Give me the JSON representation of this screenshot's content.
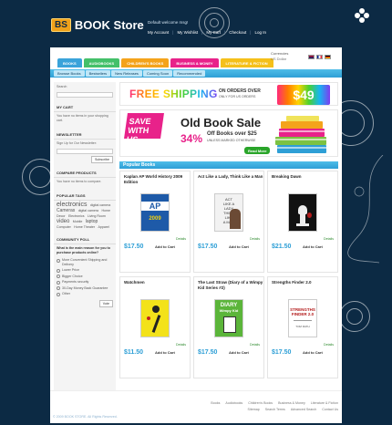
{
  "header": {
    "logo_badge": "BS",
    "logo_text": "BOOK Store",
    "welcome": "Default welcome msg!",
    "top_links": [
      "My Account",
      "My Wishlist",
      "My Cart",
      "Checkout",
      "Log In"
    ]
  },
  "nav": {
    "tabs": [
      {
        "label": "BOOKS",
        "color": "#3aa3da"
      },
      {
        "label": "AUDIOBOOKS",
        "color": "#44c06a"
      },
      {
        "label": "CHILDREN'S BOOKS",
        "color": "#f4a31b"
      },
      {
        "label": "BUSINESS & MONEY",
        "color": "#e8228a"
      },
      {
        "label": "LITERATURE & FICTION",
        "color": "#f5c01a"
      }
    ],
    "currencies_label": "Currencies",
    "currency_selected": "US Dollar",
    "subnav": [
      "Browse Books",
      "Bestsellers",
      "New Releases",
      "Coming Soon",
      "Recommended"
    ]
  },
  "sidebar": {
    "search_label": "Search",
    "cart_title": "MY CART",
    "cart_text": "You have no items in your shopping cart.",
    "newsletter_title": "NEWSLETTER",
    "newsletter_text": "Sign Up for Our Newsletter:",
    "subscribe": "Subscribe",
    "compare_title": "COMPARE PRODUCTS",
    "compare_text": "You have no items to compare.",
    "tags_title": "POPULAR TAGS",
    "tags": [
      "electronics",
      "digital camera",
      "Cameras",
      "digital camera",
      "Home Decor",
      "Electronics",
      "Living Room",
      "video",
      "Mobile",
      "laptop",
      "Computer",
      "Home Theater",
      "Apparel"
    ],
    "poll_title": "COMMUNITY POLL",
    "poll_question": "What is the main reason for you to purchase products online?",
    "poll_options": [
      "More Convenient Shipping and Delivery",
      "Lower Price",
      "Bigger Choice",
      "Payments security",
      "30-Day Money Back Guarantee",
      "Other"
    ],
    "vote": "Vote"
  },
  "banners": {
    "free_shipping": "FREE SHIPPING",
    "on_orders": "ON ORDERS OVER",
    "fine_print": "ONLY FOR US ORDERS",
    "price": "$49",
    "save": "SAVE WITH US",
    "old_sale": "Old Book Sale",
    "percent": "34%",
    "off_text": "Off Books over $25",
    "off_sub": "UNLESS MARKED OTHERWISE",
    "read_more": "Read More"
  },
  "popular": {
    "title": "Popular Books",
    "products": [
      {
        "title": "Kaplan AP World History 2009 Edition",
        "price": "$17.50",
        "details": "Details",
        "add": "Add to Cart",
        "cover_bg": "#1e5aa8"
      },
      {
        "title": "Act Like a Lady, Think Like a Man",
        "price": "$17.50",
        "details": "Details",
        "add": "Add to Cart",
        "cover_bg": "#f2f2f2"
      },
      {
        "title": "Breaking Dawn",
        "price": "$21.50",
        "details": "Details",
        "add": "Add to Cart",
        "cover_bg": "#111111"
      },
      {
        "title": "Watchmen",
        "price": "$11.50",
        "details": "Details",
        "add": "Add to Cart",
        "cover_bg": "#f3e21a"
      },
      {
        "title": "The Last Straw (Diary of a Wimpy Kid Series #2)",
        "price": "$17.50",
        "details": "Details",
        "add": "Add to Cart",
        "cover_bg": "#5bb53a"
      },
      {
        "title": "Strengths Finder 2.0",
        "price": "$17.50",
        "details": "Details",
        "add": "Add to Cart",
        "cover_bg": "#ffffff"
      }
    ]
  },
  "footer": {
    "links_row1": [
      "Books",
      "Audiobooks",
      "Children's Books",
      "Business & Money",
      "Literature & Fiction"
    ],
    "links_row2": [
      "Sitemap",
      "Search Terms",
      "Advanced Search",
      "Contact Us"
    ],
    "copyright": "© 2009 BOOK STORE. All Rights Reserved."
  }
}
